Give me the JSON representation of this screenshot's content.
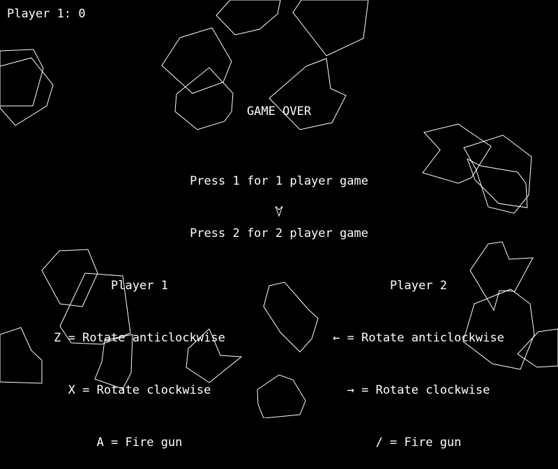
{
  "hud": {
    "score_text": "Player 1: 0"
  },
  "screen": {
    "title": "GAME OVER",
    "menu": [
      "Press 1 for 1 player game",
      "Press 2 for 2 player game"
    ]
  },
  "controls": {
    "player1": {
      "title": "Player 1",
      "lines": [
        "Z = Rotate anticlockwise",
        "X = Rotate clockwise",
        "A = Fire gun"
      ]
    },
    "player2": {
      "title": "Player 2",
      "lines": [
        "← = Rotate anticlockwise",
        "→ = Rotate clockwise",
        "/ = Fire gun"
      ]
    }
  },
  "colors": {
    "background": "#000000",
    "foreground": "#ffffff"
  }
}
